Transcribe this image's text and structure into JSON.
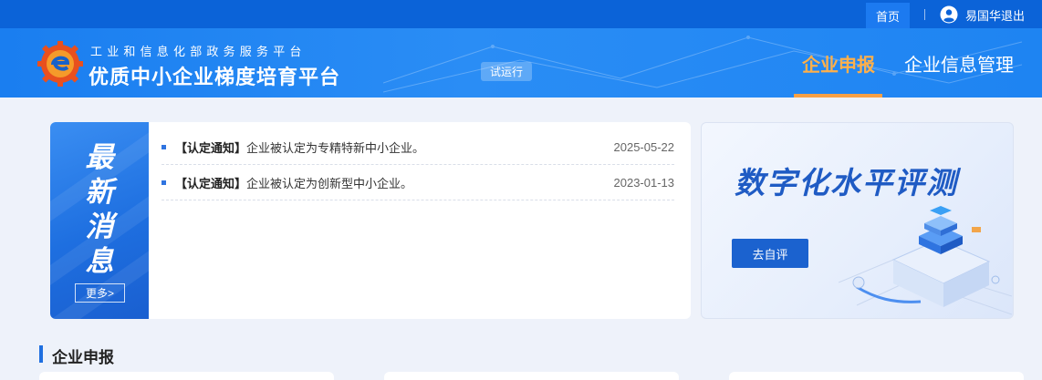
{
  "topbar": {
    "home_label": "首页",
    "user_logout_label": "易国华退出"
  },
  "header": {
    "subtitle": "工业和信息化部政务服务平台",
    "title": "优质中小企业梯度培育平台",
    "trial_badge": "试运行",
    "tabs": [
      {
        "label": "企业申报",
        "active": true
      },
      {
        "label": "企业信息管理",
        "active": false
      }
    ]
  },
  "news": {
    "side_title": [
      "最",
      "新",
      "消",
      "息"
    ],
    "more_label": "更多>",
    "items": [
      {
        "tag": "【认定通知】",
        "text": "企业被认定为专精特新中小企业。",
        "date": "2025-05-22"
      },
      {
        "tag": "【认定通知】",
        "text": "企业被认定为创新型中小企业。",
        "date": "2023-01-13"
      }
    ]
  },
  "banner": {
    "title": "数字化水平评测",
    "button_label": "去自评"
  },
  "section": {
    "title": "企业申报"
  },
  "colors": {
    "topbar": "#0b63d8",
    "header": "#1a7ef0",
    "active_tab": "#ffb04a",
    "accent": "#1f6fe0"
  }
}
